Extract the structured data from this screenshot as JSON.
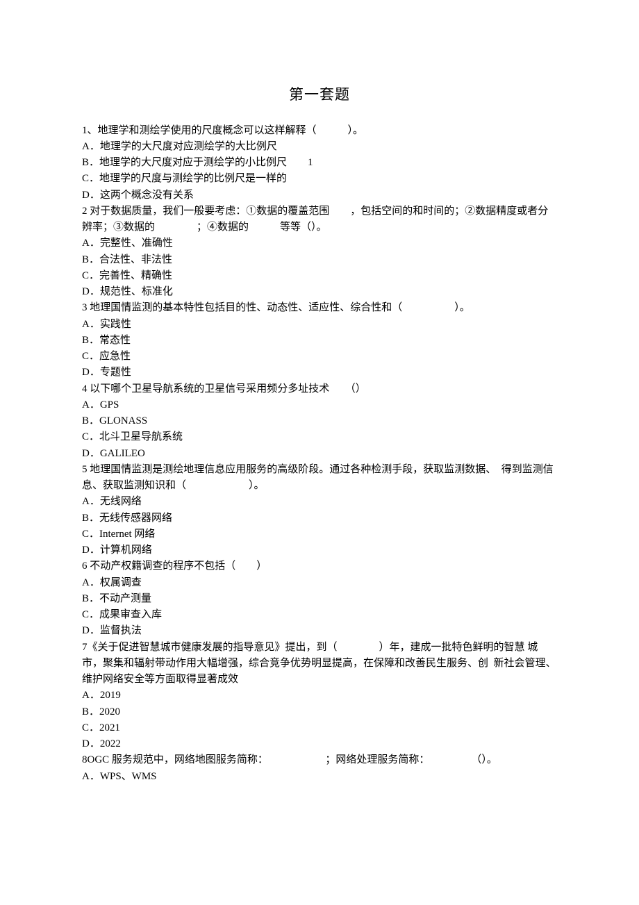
{
  "title": "第一套题",
  "questions": [
    {
      "stem_lines": [
        "1、地理学和测绘学使用的尺度概念可以这样解释（　　　）。"
      ],
      "options": [
        "A．地理学的大尺度对应测绘学的大比例尺",
        "B．地理学的大尺度对应于测绘学的小比例尺　　1",
        "C．地理学的尺度与测绘学的比例尺是一样的",
        "D．这两个概念没有关系"
      ]
    },
    {
      "stem_lines": [
        "2 对于数据质量，我们一般要考虑：①数据的覆盖范围　　，包括空间的和时间的；②数据精度或者分辨率；③数据的　　　　；④数据的　　　等等（）。"
      ],
      "options": [
        "A．完整性、准确性",
        "B．合法性、非法性",
        "C．完善性、精确性",
        "D．规范性、标准化"
      ]
    },
    {
      "stem_lines": [
        "3 地理国情监测的基本特性包括目的性、动态性、适应性、综合性和（　　　　　）。"
      ],
      "options": [
        "A．实践性",
        "B．常态性",
        "C．应急性",
        "D．专题性"
      ]
    },
    {
      "stem_lines": [
        "4 以下哪个卫星导航系统的卫星信号采用频分多址技术　　（）"
      ],
      "options": [
        "A．GPS",
        "B．GLONASS",
        "C．北斗卫星导航系统",
        "D．GALILEO"
      ]
    },
    {
      "stem_lines": [
        "5 地理国情监测是测绘地理信息应用服务的高级阶段。通过各种检测手段，获取监测数据、  得到监测信息、获取监测知识和（　　　　　　）。"
      ],
      "options": [
        "A．无线网络",
        "B．无线传感器网络",
        "C．Internet 网络",
        "D．计算机网络"
      ]
    },
    {
      "stem_lines": [
        "6 不动产权籍调查的程序不包括（　　）"
      ],
      "options": [
        "A．权属调查",
        "B．不动产测量",
        "C．成果审查入库",
        "D．监督执法"
      ]
    },
    {
      "stem_lines": [
        "7《关于促进智慧城市健康发展的指导意见》提出，到（　　　　）年，建成一批特色鲜明的智慧 城市，聚集和辐射带动作用大幅增强，综合竞争优势明显提高，在保障和改善民生服务、创  新社会管理、维护网络安全等方面取得显著成效"
      ],
      "options": [
        "A．2019",
        "B．2020",
        "C．2021",
        "D．2022"
      ]
    },
    {
      "stem_lines": [
        "8OGC 服务规范中，网络地图服务简称：　　　　　　；网络处理服务简称：　　　　　（）。"
      ],
      "options": [
        "A．WPS、WMS"
      ]
    }
  ]
}
